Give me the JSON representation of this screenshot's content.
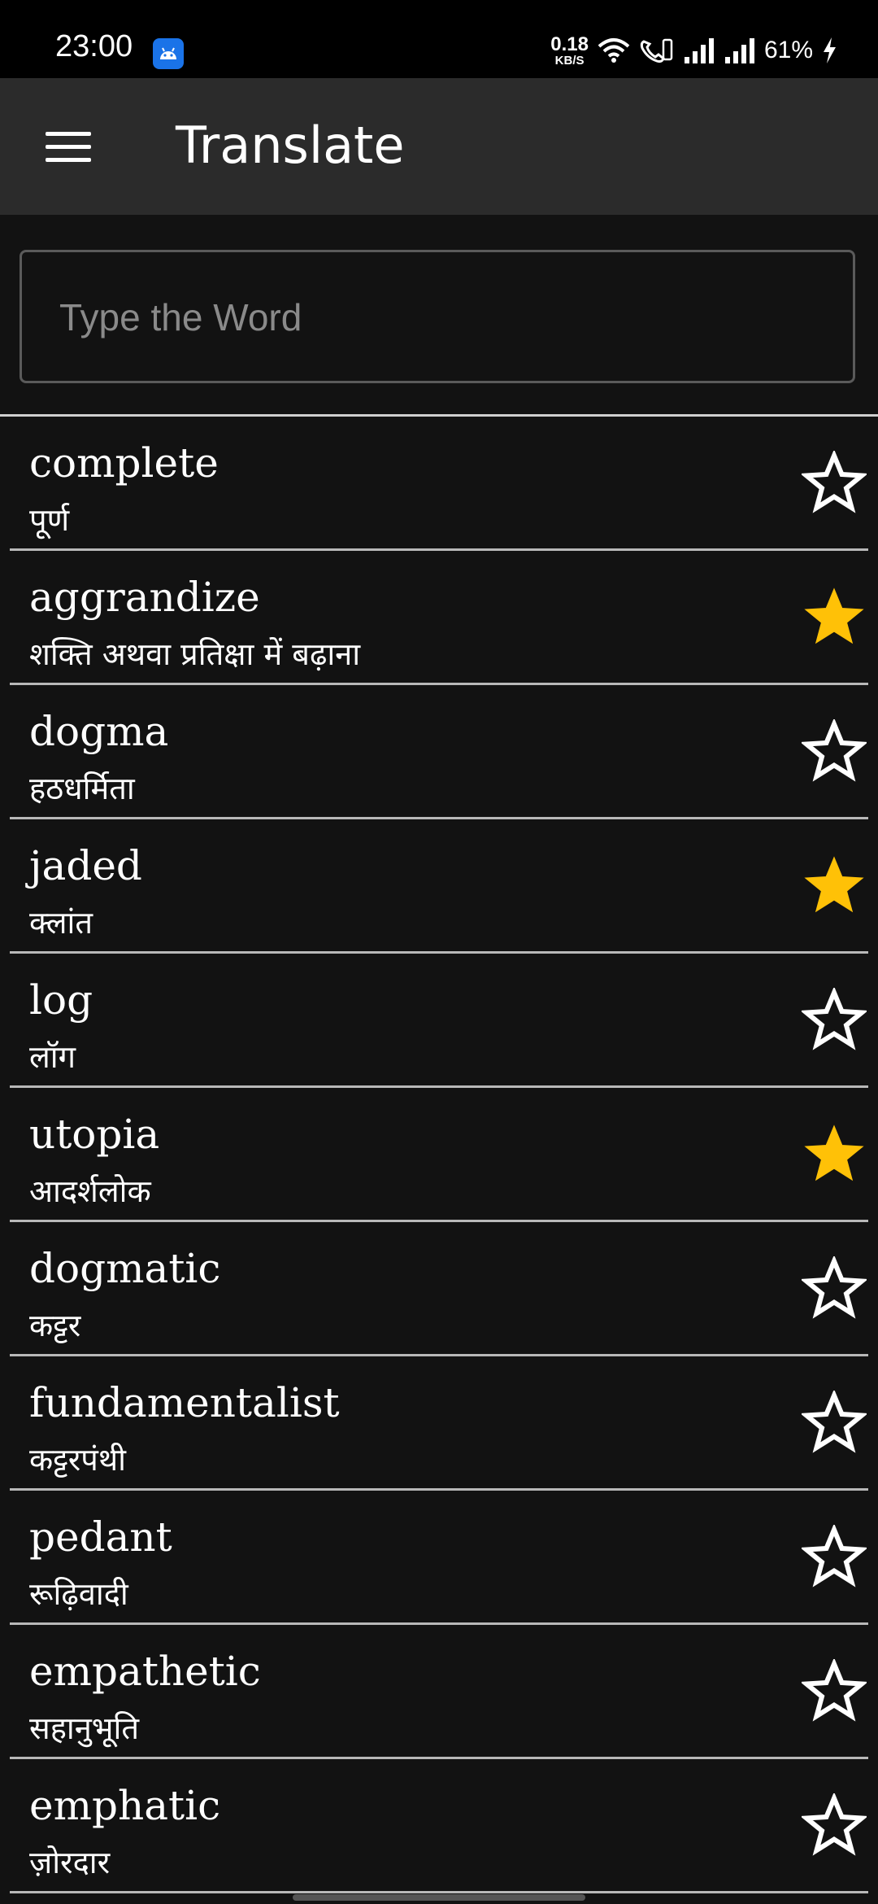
{
  "status_bar": {
    "time": "23:00",
    "net_speed_value": "0.18",
    "net_speed_unit": "KB/S",
    "battery": "61%"
  },
  "app_bar": {
    "title": "Translate"
  },
  "search": {
    "placeholder": "Type the Word",
    "value": ""
  },
  "colors": {
    "star_filled": "#FFC107",
    "background": "#121212",
    "app_bar": "#2b2b2b"
  },
  "words": [
    {
      "word": "complete",
      "translation": "पूर्ण",
      "favorite": false
    },
    {
      "word": "aggrandize",
      "translation": "शक्ति अथवा प्रतिक्षा में बढ़ाना",
      "favorite": true
    },
    {
      "word": "dogma",
      "translation": "हठधर्मिता",
      "favorite": false
    },
    {
      "word": "jaded",
      "translation": "क्लांत",
      "favorite": true
    },
    {
      "word": "log",
      "translation": "लॉग",
      "favorite": false
    },
    {
      "word": "utopia",
      "translation": "आदर्शलोक",
      "favorite": true
    },
    {
      "word": "dogmatic",
      "translation": "कट्टर",
      "favorite": false
    },
    {
      "word": "fundamentalist",
      "translation": "कट्टरपंथी",
      "favorite": false
    },
    {
      "word": "pedant",
      "translation": "रूढ़िवादी",
      "favorite": false
    },
    {
      "word": "empathetic",
      "translation": "सहानुभूति",
      "favorite": false
    },
    {
      "word": "emphatic",
      "translation": "ज़ोरदार",
      "favorite": false
    }
  ]
}
